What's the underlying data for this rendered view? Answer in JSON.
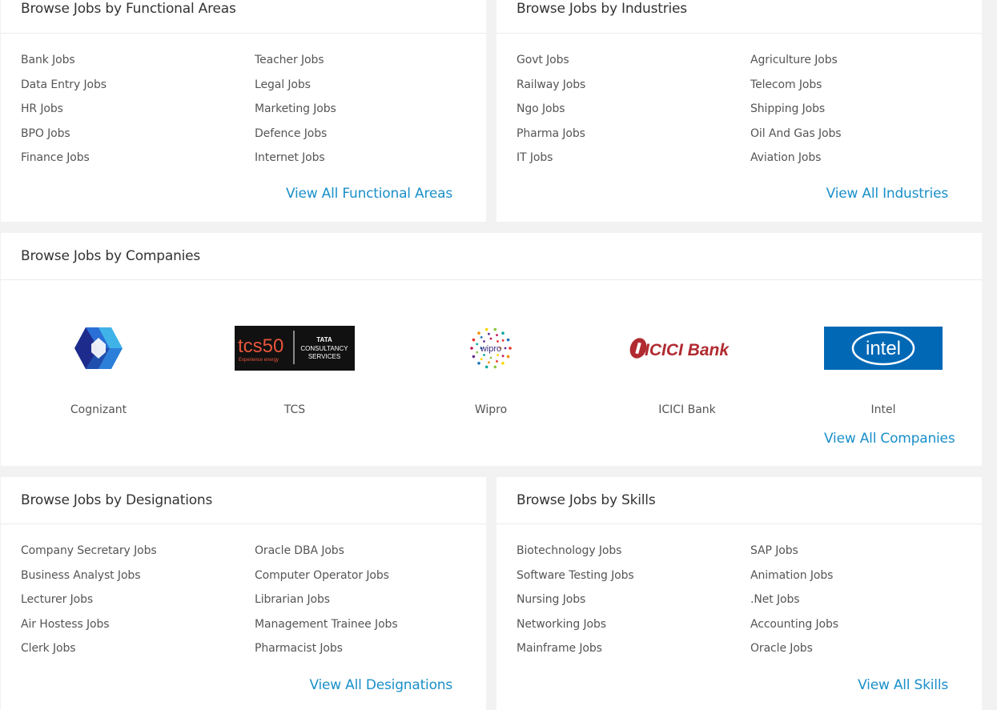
{
  "functional": {
    "title": "Browse Jobs by Functional Areas",
    "col1": [
      "Bank Jobs",
      "Data Entry Jobs",
      "HR Jobs",
      "BPO Jobs",
      "Finance Jobs"
    ],
    "col2": [
      "Teacher Jobs",
      "Legal Jobs",
      "Marketing Jobs",
      "Defence Jobs",
      "Internet Jobs"
    ],
    "view_all": "View All Functional Areas"
  },
  "industries": {
    "title": "Browse Jobs by Industries",
    "col1": [
      "Govt Jobs",
      "Railway Jobs",
      "Ngo Jobs",
      "Pharma Jobs",
      "IT Jobs"
    ],
    "col2": [
      "Agriculture Jobs",
      "Telecom Jobs",
      "Shipping Jobs",
      "Oil And Gas Jobs",
      "Aviation Jobs"
    ],
    "view_all": "View All Industries"
  },
  "companies": {
    "title": "Browse Jobs by Companies",
    "items": [
      {
        "name": "Cognizant",
        "logo": "cognizant-logo"
      },
      {
        "name": "TCS",
        "logo": "tcs-logo",
        "logo_text_1": "tcs50",
        "logo_text_2": "Experience energy",
        "logo_text_3": "TATA",
        "logo_text_4": "CONSULTANCY",
        "logo_text_5": "SERVICES"
      },
      {
        "name": "Wipro",
        "logo": "wipro-logo",
        "logo_text_1": "wipro"
      },
      {
        "name": "ICICI Bank",
        "logo": "icici-bank-logo",
        "logo_text_1": "ICICI Bank"
      },
      {
        "name": "Intel",
        "logo": "intel-logo",
        "logo_text_1": "intel"
      }
    ],
    "view_all": "View All Companies"
  },
  "designations": {
    "title": "Browse Jobs by Designations",
    "col1": [
      "Company Secretary Jobs",
      "Business Analyst Jobs",
      "Lecturer Jobs",
      "Air Hostess Jobs",
      "Clerk Jobs"
    ],
    "col2": [
      "Oracle DBA Jobs",
      "Computer Operator Jobs",
      "Librarian Jobs",
      "Management Trainee Jobs",
      "Pharmacist Jobs"
    ],
    "view_all": "View All Designations"
  },
  "skills": {
    "title": "Browse Jobs by Skills",
    "col1": [
      "Biotechnology Jobs",
      "Software Testing Jobs",
      "Nursing Jobs",
      "Networking Jobs",
      "Mainframe Jobs"
    ],
    "col2": [
      "SAP Jobs",
      "Animation Jobs",
      ".Net Jobs",
      "Accounting Jobs",
      "Oracle Jobs"
    ],
    "view_all": "View All Skills"
  },
  "colors": {
    "link_blue": "#1a8fc9",
    "text_gray": "#555555",
    "page_bg": "#f2f2f2",
    "intel_blue": "#0068b5",
    "icici_red": "#b02a30",
    "icici_navy": "#053c6d"
  }
}
